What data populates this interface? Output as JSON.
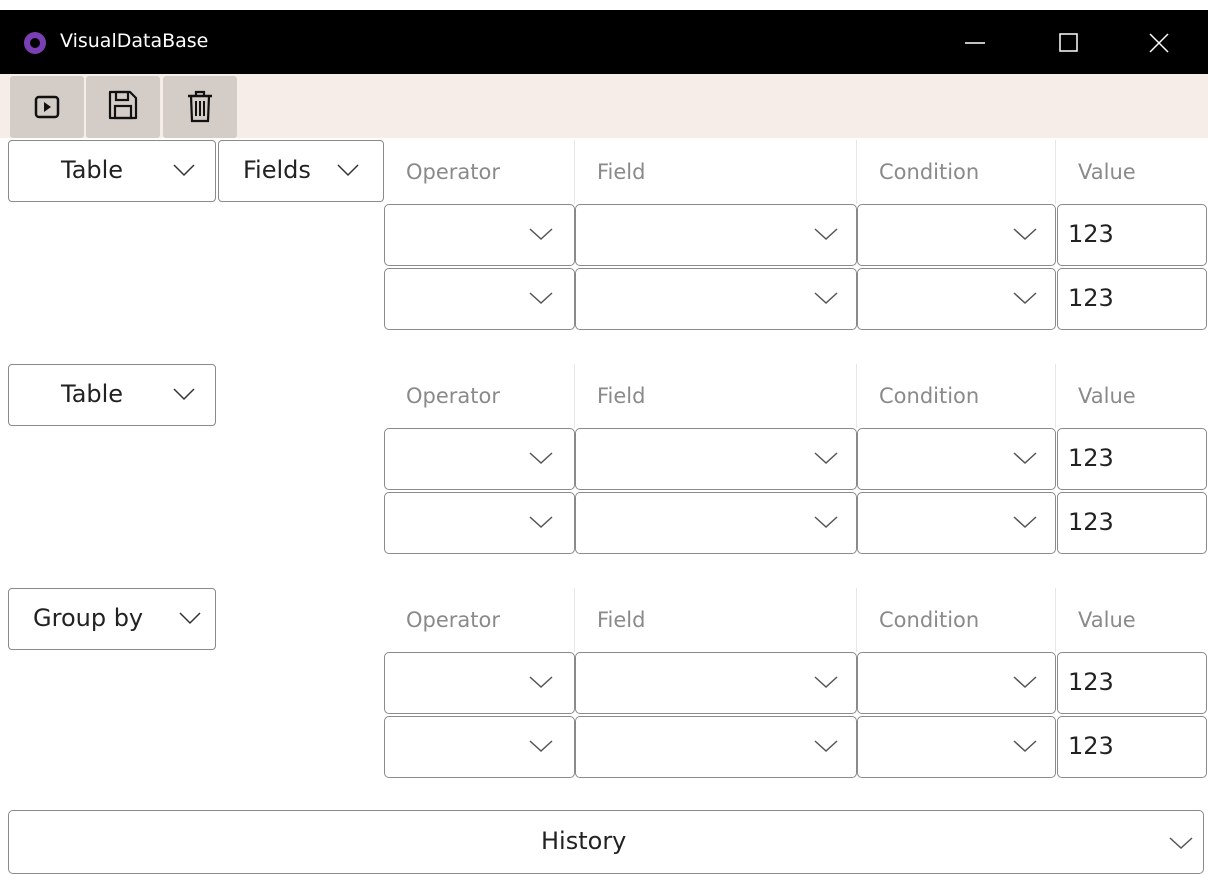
{
  "window": {
    "title": "VisualDataBase"
  },
  "toolbar": {
    "run_icon": "run-icon",
    "save_icon": "save-icon",
    "delete_icon": "trash-icon"
  },
  "section1": {
    "table_dropdown": "Table",
    "fields_dropdown": "Fields",
    "headers": [
      "Operator",
      "Field",
      "Condition",
      "Value"
    ],
    "rows": [
      {
        "operator": "",
        "field": "",
        "condition": "",
        "value": "123"
      },
      {
        "operator": "",
        "field": "",
        "condition": "",
        "value": "123"
      }
    ]
  },
  "section2": {
    "table_dropdown": "Table",
    "headers": [
      "Operator",
      "Field",
      "Condition",
      "Value"
    ],
    "rows": [
      {
        "operator": "",
        "field": "",
        "condition": "",
        "value": "123"
      },
      {
        "operator": "",
        "field": "",
        "condition": "",
        "value": "123"
      }
    ]
  },
  "section3": {
    "group_dropdown": "Group by",
    "headers": [
      "Operator",
      "Field",
      "Condition",
      "Value"
    ],
    "rows": [
      {
        "operator": "",
        "field": "",
        "condition": "",
        "value": "123"
      },
      {
        "operator": "",
        "field": "",
        "condition": "",
        "value": "123"
      }
    ]
  },
  "history": {
    "label": "History"
  }
}
